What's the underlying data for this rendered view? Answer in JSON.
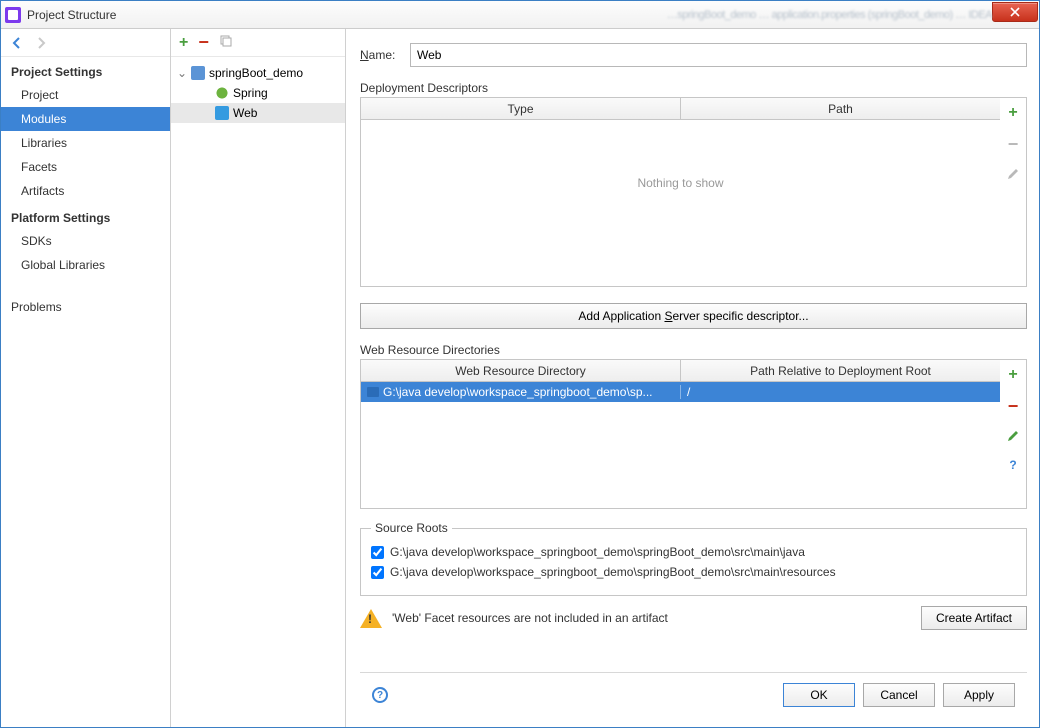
{
  "window": {
    "title": "Project Structure",
    "blurred_path": "…springBoot_demo … application.properties (springBoot_demo) … IDEA"
  },
  "sidebar": {
    "section1": "Project Settings",
    "items1": [
      "Project",
      "Modules",
      "Libraries",
      "Facets",
      "Artifacts"
    ],
    "selected1": 1,
    "section2": "Platform Settings",
    "items2": [
      "SDKs",
      "Global Libraries"
    ],
    "problems": "Problems"
  },
  "tree": {
    "root": "springBoot_demo",
    "children": [
      {
        "icon": "spring",
        "label": "Spring"
      },
      {
        "icon": "web",
        "label": "Web",
        "selected": true
      }
    ]
  },
  "main": {
    "name_label": "Name:",
    "name_value": "Web",
    "deploy_label": "Deployment Descriptors",
    "deploy_cols": [
      "Type",
      "Path"
    ],
    "deploy_empty": "Nothing to show",
    "add_desc_btn": "Add Application Server specific descriptor...",
    "res_label": "Web Resource Directories",
    "res_cols": [
      "Web Resource Directory",
      "Path Relative to Deployment Root"
    ],
    "res_row": {
      "dir": "G:\\java develop\\workspace_springboot_demo\\sp...",
      "rel": "/"
    },
    "roots_label": "Source Roots",
    "roots": [
      "G:\\java develop\\workspace_springboot_demo\\springBoot_demo\\src\\main\\java",
      "G:\\java develop\\workspace_springboot_demo\\springBoot_demo\\src\\main\\resources"
    ],
    "warn_msg": "'Web' Facet resources are not included in an artifact",
    "create_artifact": "Create Artifact"
  },
  "footer": {
    "ok": "OK",
    "cancel": "Cancel",
    "apply": "Apply"
  }
}
